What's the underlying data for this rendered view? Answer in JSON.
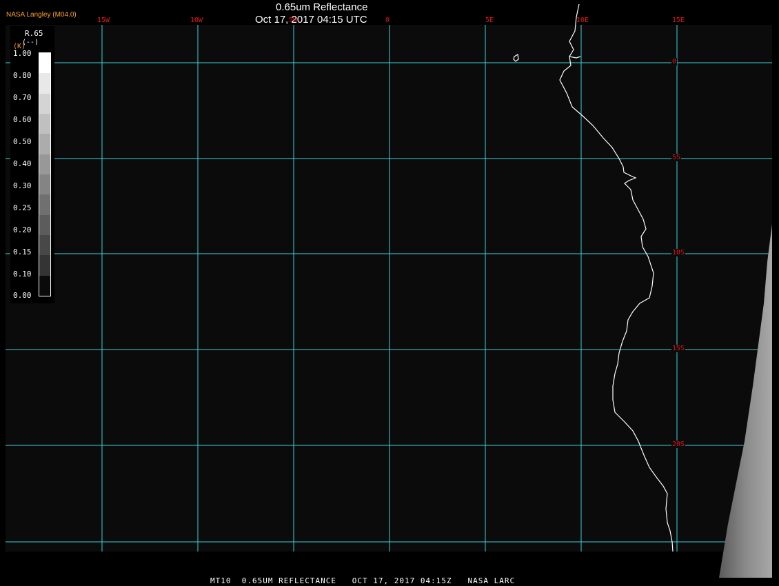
{
  "header": {
    "title": "0.65um Reflectance",
    "subtitle": "Oct 17, 2017 04:15 UTC",
    "brand": "NASA Langley (M04.0)"
  },
  "grid": {
    "longitudes": [
      "15W",
      "10W",
      "5W",
      "0",
      "5E",
      "10E",
      "15E"
    ],
    "latitudes": [
      "0",
      "5S",
      "10S",
      "15S",
      "20S"
    ]
  },
  "legend": {
    "variable": "R.65",
    "unit": "(--)",
    "extra": "(K)",
    "ticks": [
      "1.00",
      "0.80",
      "0.70",
      "0.60",
      "0.50",
      "0.40",
      "0.30",
      "0.25",
      "0.20",
      "0.15",
      "0.10",
      "0.00"
    ],
    "colors": [
      "#ffffff",
      "#e8e8e8",
      "#d4d4d4",
      "#c0c0c0",
      "#acacac",
      "#989898",
      "#848484",
      "#707070",
      "#5c5c5c",
      "#484848",
      "#343434",
      "#0a0a0a"
    ]
  },
  "footer": "MT10  0.65UM REFLECTANCE   OCT 17, 2017 04:15Z   NASA LARC",
  "colors": {
    "grid": "#40d0d8",
    "labels": "#e01414",
    "brand": "#ffa020",
    "coastline": "#ffffff"
  }
}
